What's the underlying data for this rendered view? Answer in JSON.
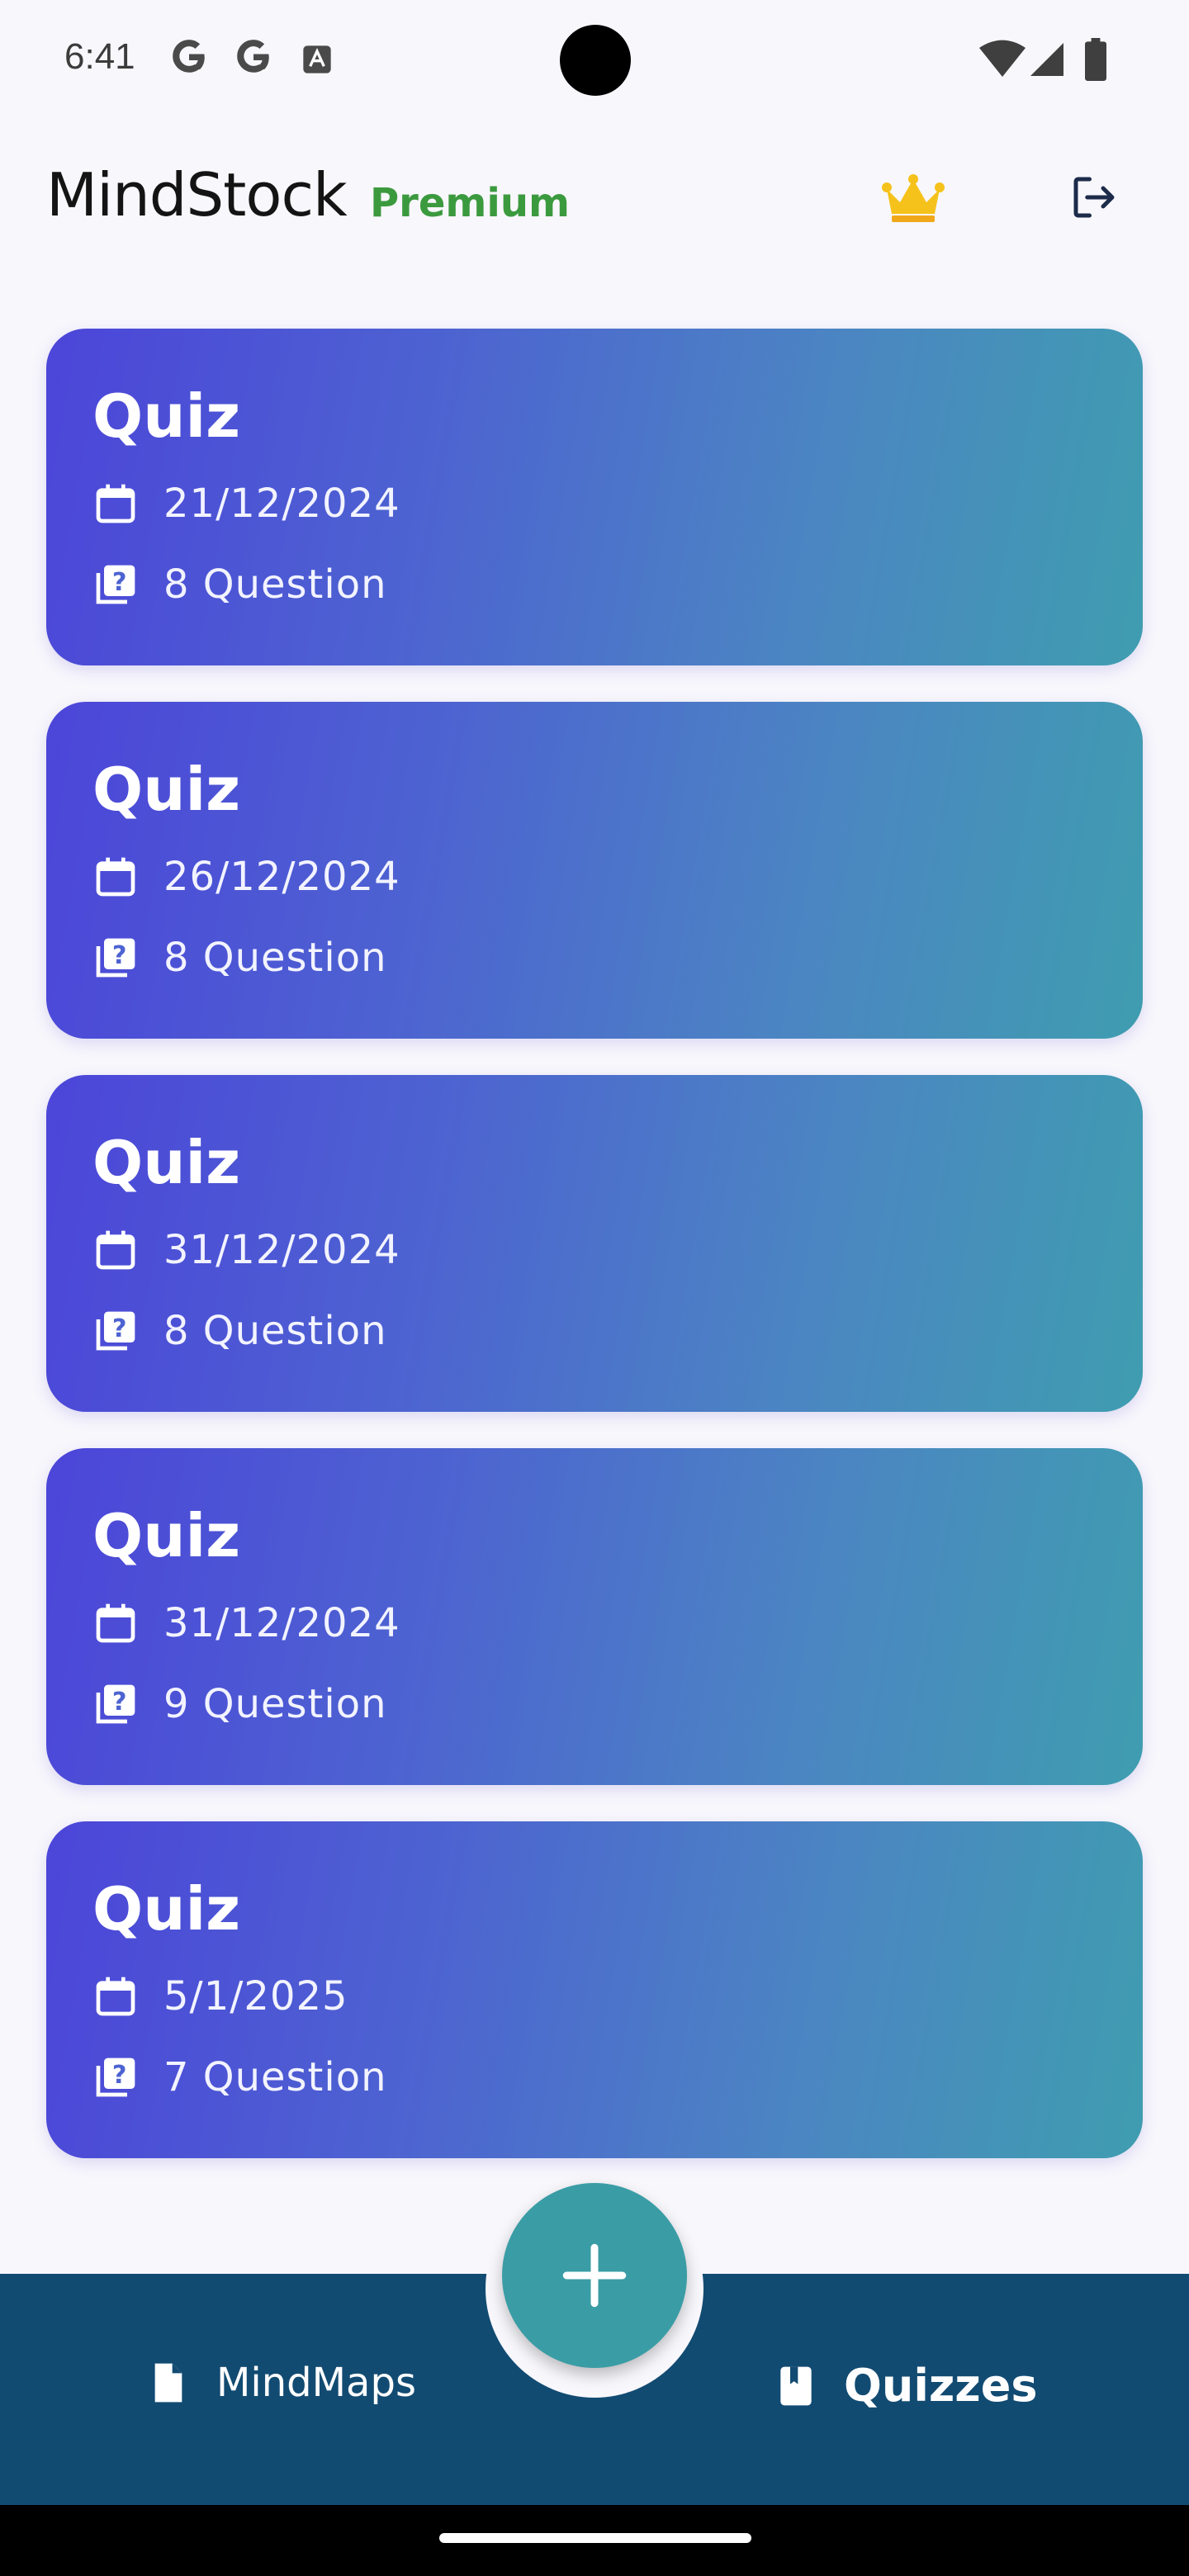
{
  "status": {
    "time": "6:41"
  },
  "appbar": {
    "title": "MindStock",
    "badge": "Premium"
  },
  "quizzes": [
    {
      "title": "Quiz",
      "date": "21/12/2024",
      "count": "8 Question"
    },
    {
      "title": "Quiz",
      "date": "26/12/2024",
      "count": "8 Question"
    },
    {
      "title": "Quiz",
      "date": "31/12/2024",
      "count": "8 Question"
    },
    {
      "title": "Quiz",
      "date": "31/12/2024",
      "count": "9 Question"
    },
    {
      "title": "Quiz",
      "date": "5/1/2025",
      "count": "7 Question"
    }
  ],
  "bottom_nav": {
    "mindmaps_label": "MindMaps",
    "quizzes_label": "Quizzes"
  },
  "icons": {
    "status": [
      "google-g-icon",
      "google-g-icon",
      "font-a-icon",
      "wifi-icon",
      "signal-icon",
      "battery-icon"
    ],
    "appbar": [
      "crown-icon",
      "logout-icon"
    ],
    "card": [
      "calendar-icon",
      "question-book-icon"
    ],
    "nav": [
      "document-icon",
      "book-icon",
      "plus-icon"
    ]
  },
  "colors": {
    "gradient_start": "#4c45d9",
    "gradient_end": "#3f9db0",
    "premium": "#3c9a3e",
    "crown": "#f5c21b",
    "fab": "#3a9da5",
    "bottom_bar": "#124b72"
  }
}
